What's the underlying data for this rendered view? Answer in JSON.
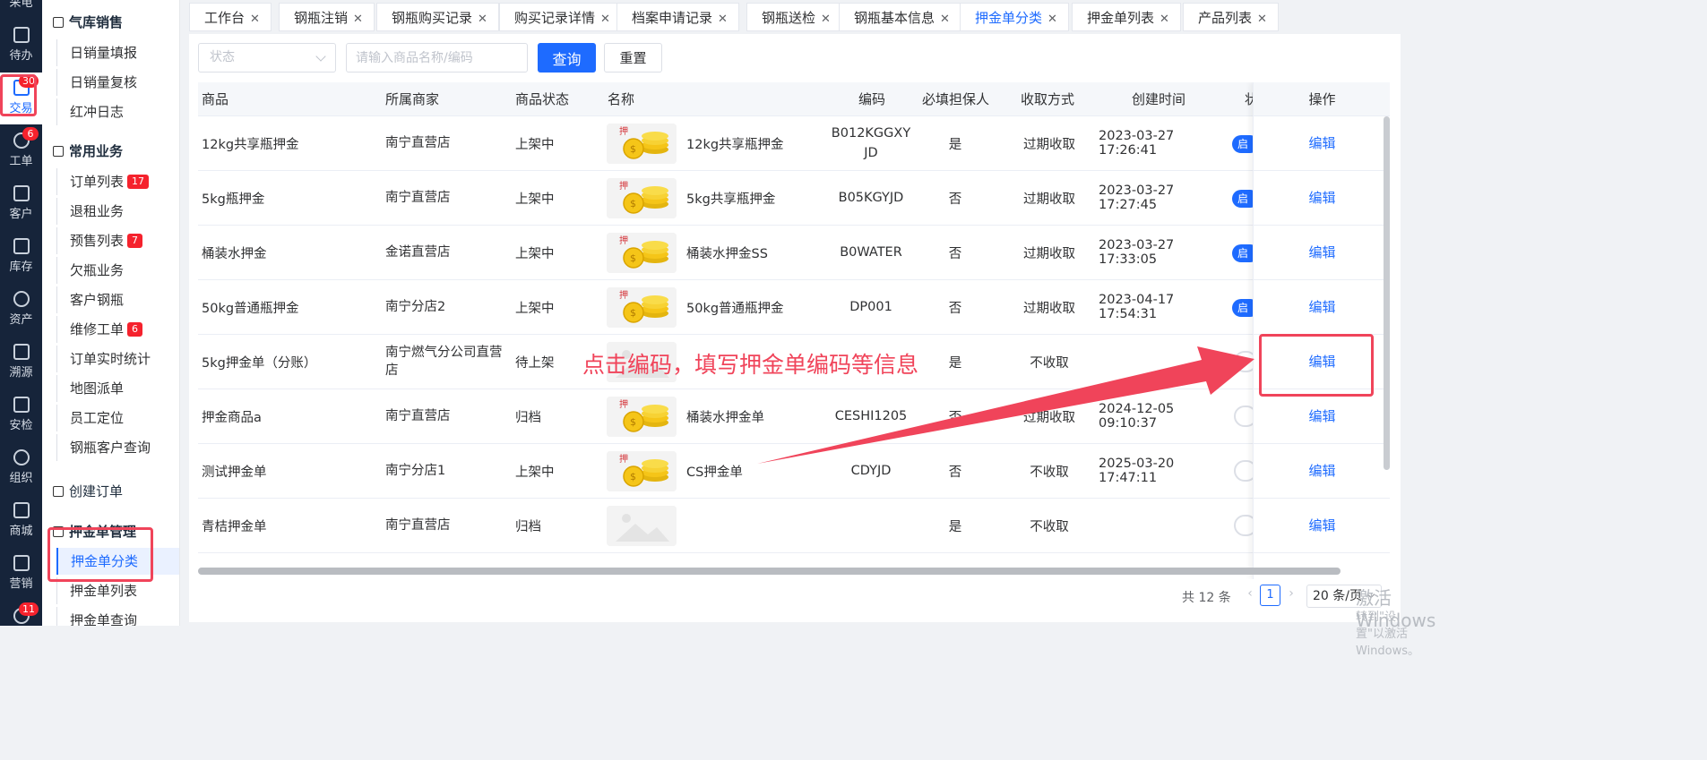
{
  "rail": {
    "top_label": "采电",
    "items": [
      {
        "label": "待办",
        "icon": "todo-icon"
      },
      {
        "label": "交易",
        "icon": "trade-icon",
        "badge": "30"
      },
      {
        "label": "工单",
        "icon": "workorder-icon",
        "badge": "6"
      },
      {
        "label": "客户",
        "icon": "customer-icon"
      },
      {
        "label": "库存",
        "icon": "inventory-icon"
      },
      {
        "label": "资产",
        "icon": "asset-icon"
      },
      {
        "label": "溯源",
        "icon": "trace-icon"
      },
      {
        "label": "安检",
        "icon": "safety-icon"
      },
      {
        "label": "组织",
        "icon": "org-icon"
      },
      {
        "label": "商城",
        "icon": "mall-icon"
      },
      {
        "label": "营销",
        "icon": "trophy-icon"
      },
      {
        "label": "",
        "icon": "more-icon",
        "badge": "11"
      }
    ]
  },
  "submenu": {
    "group1": "气库销售",
    "group1_items": [
      "日销量填报",
      "日销量复核",
      "红冲日志"
    ],
    "group2": "常用业务",
    "group2_items": [
      {
        "label": "订单列表",
        "badge": "17"
      },
      {
        "label": "退租业务",
        "badge": ""
      },
      {
        "label": "预售列表",
        "badge": "7"
      },
      {
        "label": "欠瓶业务",
        "badge": ""
      },
      {
        "label": "客户钢瓶",
        "badge": ""
      },
      {
        "label": "维修工单",
        "badge": "6"
      },
      {
        "label": "订单实时统计",
        "badge": ""
      },
      {
        "label": "地图派单",
        "badge": ""
      },
      {
        "label": "员工定位",
        "badge": ""
      },
      {
        "label": "钢瓶客户查询",
        "badge": ""
      }
    ],
    "create_order": "创建订单",
    "group3": "押金单管理",
    "group3_items": [
      "押金单分类",
      "押金单列表",
      "押金单查询"
    ]
  },
  "tabs": [
    "工作台",
    "钢瓶注销",
    "钢瓶购买记录",
    "购买记录详情",
    "档案申请记录",
    "钢瓶送检",
    "钢瓶基本信息",
    "押金单分类",
    "押金单列表",
    "产品列表"
  ],
  "filters": {
    "status_placeholder": "状态",
    "search_placeholder": "请输入商品名称/编码",
    "query_label": "查询",
    "reset_label": "重置"
  },
  "table": {
    "headers": [
      "商品",
      "所属商家",
      "商品状态",
      "名称",
      "编码",
      "必填担保人",
      "收取方式",
      "创建时间",
      "状",
      "操作"
    ],
    "rows": [
      {
        "product": "12kg共享瓶押金",
        "merchant": "南宁直营店",
        "status": "上架中",
        "name": "12kg共享瓶押金",
        "code": "B012KGGXYJD",
        "guarantor": "是",
        "method": "过期收取",
        "created": "2023-03-27 17:26:41",
        "toggle": "on",
        "img": "coin"
      },
      {
        "product": "5kg瓶押金",
        "merchant": "南宁直营店",
        "status": "上架中",
        "name": "5kg共享瓶押金",
        "code": "B05KGYJD",
        "guarantor": "否",
        "method": "过期收取",
        "created": "2023-03-27 17:27:45",
        "toggle": "on",
        "img": "coin"
      },
      {
        "product": "桶装水押金",
        "merchant": "金诺直营店",
        "status": "上架中",
        "name": "桶装水押金SS",
        "code": "B0WATER",
        "guarantor": "否",
        "method": "过期收取",
        "created": "2023-03-27 17:33:05",
        "toggle": "on",
        "img": "coin"
      },
      {
        "product": "50kg普通瓶押金",
        "merchant": "南宁分店2",
        "status": "上架中",
        "name": "50kg普通瓶押金",
        "code": "DP001",
        "guarantor": "否",
        "method": "过期收取",
        "created": "2023-04-17 17:54:31",
        "toggle": "on",
        "img": "coin"
      },
      {
        "product": "5kg押金单（分账）",
        "merchant": "南宁燃气分公司直营店",
        "status": "待上架",
        "name": "",
        "code": "",
        "guarantor": "是",
        "method": "不收取",
        "created": "",
        "toggle": "off",
        "img": "placeholder"
      },
      {
        "product": "押金商品a",
        "merchant": "南宁直营店",
        "status": "归档",
        "name": "桶装水押金单",
        "code": "CESHI1205",
        "guarantor": "否",
        "method": "过期收取",
        "created": "2024-12-05 09:10:37",
        "toggle": "off",
        "img": "coin"
      },
      {
        "product": "测试押金单",
        "merchant": "南宁分店1",
        "status": "上架中",
        "name": "CS押金单",
        "code": "CDYJD",
        "guarantor": "否",
        "method": "不收取",
        "created": "2025-03-20 17:47:11",
        "toggle": "off",
        "img": "coin"
      },
      {
        "product": "青桔押金单",
        "merchant": "南宁直营店",
        "status": "归档",
        "name": "",
        "code": "",
        "guarantor": "是",
        "method": "不收取",
        "created": "",
        "toggle": "off",
        "img": "placeholder"
      }
    ],
    "toggle_on_text": "启",
    "edit_label": "编辑"
  },
  "pagination": {
    "total": "共 12 条",
    "current_page": "1",
    "page_size": "20 条/页"
  },
  "watermark": {
    "line1": "激活 Windows",
    "line2": "转到\"设置\"以激活 Windows。"
  },
  "annotation": {
    "text": "点击编码，填写押金单编码等信息",
    "color": "#f0445a"
  },
  "colors": {
    "primary": "#1e6bff",
    "rail_bg": "#16243a",
    "badge": "#f5222d"
  }
}
